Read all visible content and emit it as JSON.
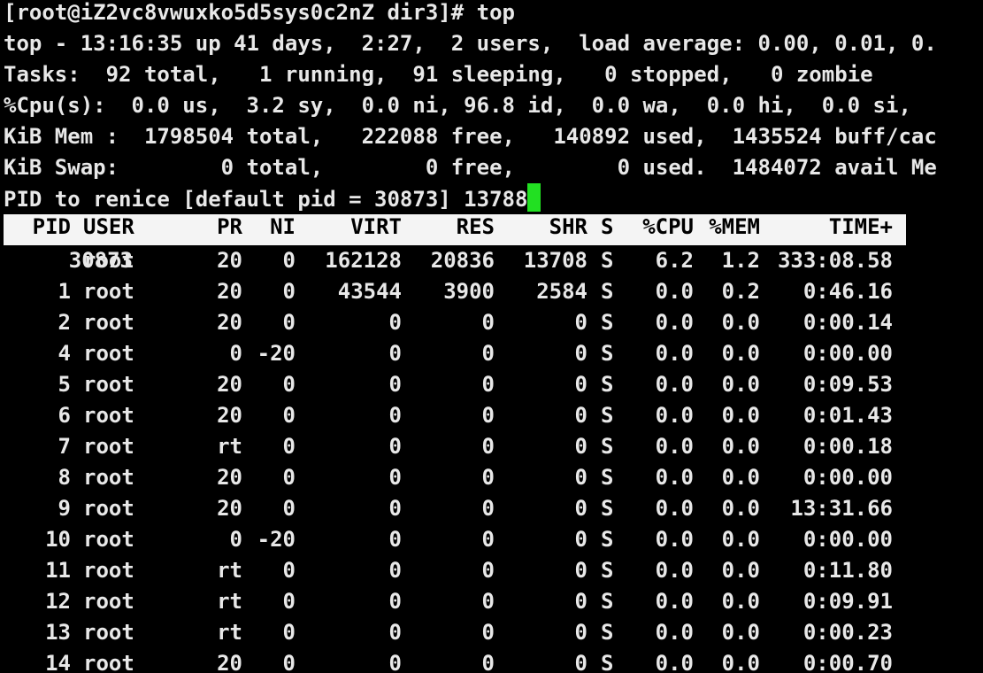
{
  "prompt_line": "[root@iZ2vc8vwuxko5d5sys0c2nZ dir3]# top",
  "summary": [
    "top - 13:16:35 up 41 days,  2:27,  2 users,  load average: 0.00, 0.01, 0.",
    "Tasks:  92 total,   1 running,  91 sleeping,   0 stopped,   0 zombie",
    "%Cpu(s):  0.0 us,  3.2 sy,  0.0 ni, 96.8 id,  0.0 wa,  0.0 hi,  0.0 si,",
    "KiB Mem :  1798504 total,   222088 free,   140892 used,  1435524 buff/cac",
    "KiB Swap:        0 total,        0 free,        0 used.  1484072 avail Me"
  ],
  "renice_prompt": "PID to renice [default pid = 30873] 13788",
  "colors": {
    "background": "#000000",
    "text": "#e8e8e8",
    "header_bg": "#f4f4f4",
    "header_text": "#000000",
    "cursor": "#22e022"
  },
  "table": {
    "columns": [
      "PID",
      "USER",
      "PR",
      "NI",
      "VIRT",
      "RES",
      "SHR",
      "S",
      "%CPU",
      "%MEM",
      "TIME+"
    ],
    "rows": [
      [
        "30873",
        "root",
        "20",
        "0",
        "162128",
        "20836",
        "13708",
        "S",
        "6.2",
        "1.2",
        "333:08.58"
      ],
      [
        "1",
        "root",
        "20",
        "0",
        "43544",
        "3900",
        "2584",
        "S",
        "0.0",
        "0.2",
        "0:46.16"
      ],
      [
        "2",
        "root",
        "20",
        "0",
        "0",
        "0",
        "0",
        "S",
        "0.0",
        "0.0",
        "0:00.14"
      ],
      [
        "4",
        "root",
        "0",
        "-20",
        "0",
        "0",
        "0",
        "S",
        "0.0",
        "0.0",
        "0:00.00"
      ],
      [
        "5",
        "root",
        "20",
        "0",
        "0",
        "0",
        "0",
        "S",
        "0.0",
        "0.0",
        "0:09.53"
      ],
      [
        "6",
        "root",
        "20",
        "0",
        "0",
        "0",
        "0",
        "S",
        "0.0",
        "0.0",
        "0:01.43"
      ],
      [
        "7",
        "root",
        "rt",
        "0",
        "0",
        "0",
        "0",
        "S",
        "0.0",
        "0.0",
        "0:00.18"
      ],
      [
        "8",
        "root",
        "20",
        "0",
        "0",
        "0",
        "0",
        "S",
        "0.0",
        "0.0",
        "0:00.00"
      ],
      [
        "9",
        "root",
        "20",
        "0",
        "0",
        "0",
        "0",
        "S",
        "0.0",
        "0.0",
        "13:31.66"
      ],
      [
        "10",
        "root",
        "0",
        "-20",
        "0",
        "0",
        "0",
        "S",
        "0.0",
        "0.0",
        "0:00.00"
      ],
      [
        "11",
        "root",
        "rt",
        "0",
        "0",
        "0",
        "0",
        "S",
        "0.0",
        "0.0",
        "0:11.80"
      ],
      [
        "12",
        "root",
        "rt",
        "0",
        "0",
        "0",
        "0",
        "S",
        "0.0",
        "0.0",
        "0:09.91"
      ],
      [
        "13",
        "root",
        "rt",
        "0",
        "0",
        "0",
        "0",
        "S",
        "0.0",
        "0.0",
        "0:00.23"
      ],
      [
        "14",
        "root",
        "20",
        "0",
        "0",
        "0",
        "0",
        "S",
        "0.0",
        "0.0",
        "0:00.70"
      ]
    ]
  }
}
